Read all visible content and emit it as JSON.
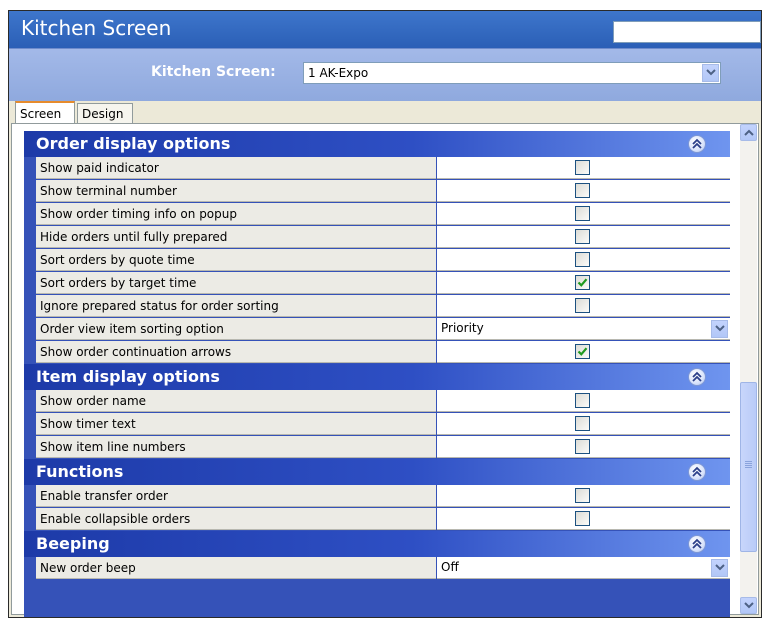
{
  "window": {
    "title": "Kitchen Screen"
  },
  "selector": {
    "label": "Kitchen Screen:",
    "value": "1 AK-Expo"
  },
  "tabs": [
    {
      "label": "Screen",
      "active": true
    },
    {
      "label": "Design",
      "active": false
    }
  ],
  "sections": [
    {
      "title": "Order display options",
      "rows": [
        {
          "label": "Show paid indicator",
          "type": "checkbox",
          "checked": false
        },
        {
          "label": "Show terminal number",
          "type": "checkbox",
          "checked": false
        },
        {
          "label": "Show order timing info on popup",
          "type": "checkbox",
          "checked": false
        },
        {
          "label": "Hide orders until fully prepared",
          "type": "checkbox",
          "checked": false
        },
        {
          "label": "Sort orders by quote time",
          "type": "checkbox",
          "checked": false
        },
        {
          "label": "Sort orders by target time",
          "type": "checkbox",
          "checked": true
        },
        {
          "label": "Ignore prepared status for order sorting",
          "type": "checkbox",
          "checked": false
        },
        {
          "label": "Order view item sorting option",
          "type": "dropdown",
          "value": "Priority"
        },
        {
          "label": "Show order continuation arrows",
          "type": "checkbox",
          "checked": true
        }
      ]
    },
    {
      "title": "Item display options",
      "rows": [
        {
          "label": "Show order name",
          "type": "checkbox",
          "checked": false
        },
        {
          "label": "Show timer text",
          "type": "checkbox",
          "checked": false
        },
        {
          "label": "Show item line numbers",
          "type": "checkbox",
          "checked": false
        }
      ]
    },
    {
      "title": "Functions",
      "rows": [
        {
          "label": "Enable transfer order",
          "type": "checkbox",
          "checked": false
        },
        {
          "label": "Enable collapsible orders",
          "type": "checkbox",
          "checked": false
        }
      ]
    },
    {
      "title": "Beeping",
      "rows": [
        {
          "label": "New order beep",
          "type": "dropdown",
          "value": "Off"
        }
      ]
    }
  ],
  "icons": {
    "collapse": "double-chevron-up-icon",
    "dropdown": "chevron-down-icon",
    "check": "checkmark-icon"
  },
  "colors": {
    "title_bar": "#2b5fb6",
    "section_header": "#1d3aa8",
    "check": "#1f9a1f"
  }
}
